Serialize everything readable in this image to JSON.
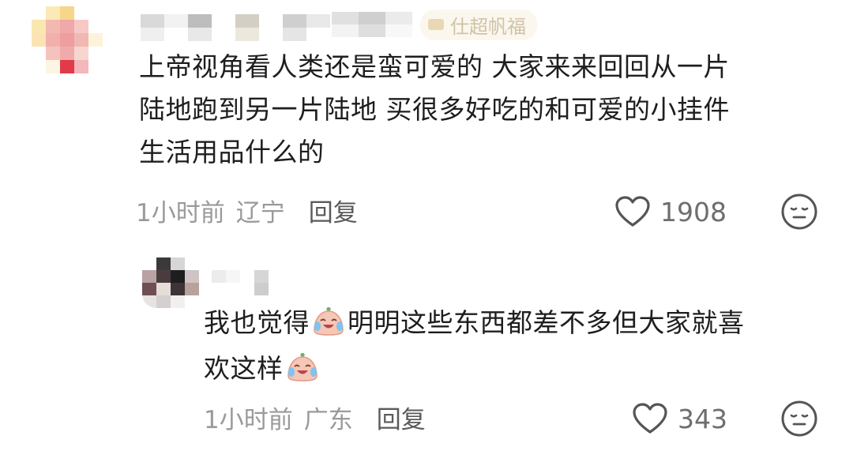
{
  "comments": [
    {
      "text_line1": "上帝视角看人类还是蛮可爱的 大家来来回回从一片",
      "text_line2": "陆地跑到另一片陆地 买很多好吃的和可爱的小挂件",
      "text_line3": "生活用品什么的",
      "time": "1小时前",
      "location": "辽宁",
      "reply_label": "回复",
      "likes": "1908",
      "header_badge_text": "仕超帆福"
    },
    {
      "text_part1": "我也觉得",
      "text_part2": "明明这些东西都差不多但大家就喜",
      "text_line2": "欢这样",
      "time": "1小时前",
      "location": "广东",
      "reply_label": "回复",
      "likes": "343"
    }
  ],
  "icons": {
    "like": "heart-outline-icon",
    "dislike": "neutral-face-icon",
    "emoji": "crying-laughing-sticker-icon"
  },
  "colors": {
    "text": "#1e1e1e",
    "meta": "#9a9a9a",
    "reply": "#5a5a5a",
    "icon": "#555555"
  }
}
